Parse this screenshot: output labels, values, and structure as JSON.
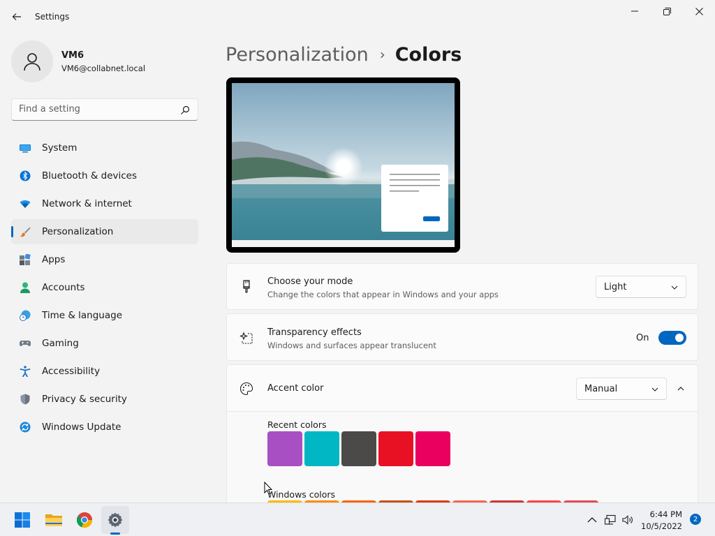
{
  "window": {
    "title": "Settings"
  },
  "profile": {
    "name": "VM6",
    "email": "VM6@collabnet.local"
  },
  "search": {
    "placeholder": "Find a setting"
  },
  "sidebar": {
    "items": [
      {
        "label": "System",
        "icon": "monitor-icon"
      },
      {
        "label": "Bluetooth & devices",
        "icon": "bluetooth-icon"
      },
      {
        "label": "Network & internet",
        "icon": "wifi-icon"
      },
      {
        "label": "Personalization",
        "icon": "brush-icon",
        "active": true
      },
      {
        "label": "Apps",
        "icon": "apps-icon"
      },
      {
        "label": "Accounts",
        "icon": "person-icon"
      },
      {
        "label": "Time & language",
        "icon": "clock-globe-icon"
      },
      {
        "label": "Gaming",
        "icon": "gamepad-icon"
      },
      {
        "label": "Accessibility",
        "icon": "accessibility-icon"
      },
      {
        "label": "Privacy & security",
        "icon": "shield-icon"
      },
      {
        "label": "Windows Update",
        "icon": "update-icon"
      }
    ]
  },
  "breadcrumb": {
    "parent": "Personalization",
    "separator": "›",
    "current": "Colors"
  },
  "mode_card": {
    "title": "Choose your mode",
    "description": "Change the colors that appear in Windows and your apps",
    "selected": "Light"
  },
  "transparency_card": {
    "title": "Transparency effects",
    "description": "Windows and surfaces appear translucent",
    "state_label": "On",
    "enabled": true
  },
  "accent_card": {
    "title": "Accent color",
    "selected": "Manual",
    "recent_label": "Recent colors",
    "recent_colors": [
      "#a84fc4",
      "#00b7c3",
      "#4c4a48",
      "#e81123",
      "#ea005e"
    ],
    "windows_label": "Windows colors",
    "windows_colors": [
      "#ffb900",
      "#ff8c00",
      "#f7630c",
      "#ca5010",
      "#da3b01",
      "#ef6950",
      "#d13438",
      "#ff4343",
      "#e74856"
    ]
  },
  "colors": {
    "accent": "#0067c0",
    "background": "#f3f3f3",
    "card": "#fbfbfb"
  },
  "taskbar": {
    "time": "6:44 PM",
    "date": "10/5/2022",
    "notifications": "2",
    "apps": [
      "start-icon",
      "file-explorer-icon",
      "chrome-icon",
      "settings-icon"
    ]
  }
}
